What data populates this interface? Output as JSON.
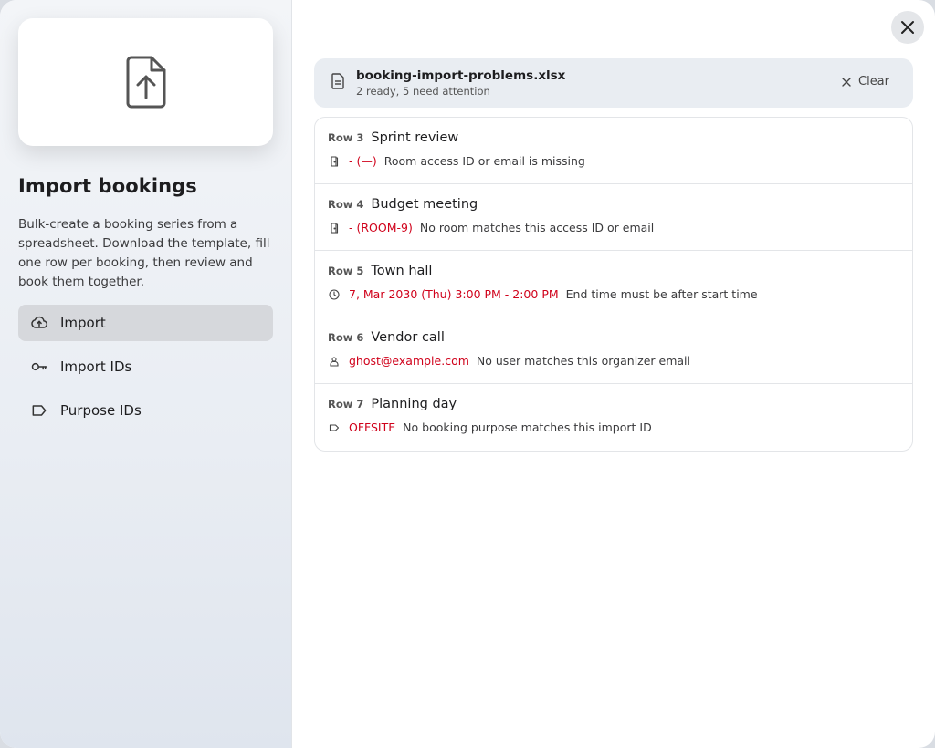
{
  "sidebar": {
    "title": "Import bookings",
    "description": "Bulk-create a booking series from a spreadsheet. Download the template, fill one row per booking, then review and book them together.",
    "nav": [
      {
        "label": "Import",
        "icon": "cloud-upload-icon",
        "active": true
      },
      {
        "label": "Import IDs",
        "icon": "key-icon",
        "active": false
      },
      {
        "label": "Purpose IDs",
        "icon": "tag-icon",
        "active": false
      }
    ]
  },
  "file": {
    "name": "booking-import-problems.xlsx",
    "status": "2 ready, 5 need attention",
    "clear_label": "Clear"
  },
  "issues": [
    {
      "row": "Row 3",
      "title": "Sprint review",
      "icon": "door-icon",
      "value": "- (—)",
      "message": "Room access ID or email is missing"
    },
    {
      "row": "Row 4",
      "title": "Budget meeting",
      "icon": "door-icon",
      "value": "- (ROOM-9)",
      "message": "No room matches this access ID or email"
    },
    {
      "row": "Row 5",
      "title": "Town hall",
      "icon": "clock-icon",
      "value": "7, Mar 2030 (Thu) 3:00 PM - 2:00 PM",
      "message": "End time must be after start time"
    },
    {
      "row": "Row 6",
      "title": "Vendor call",
      "icon": "person-icon",
      "value": "ghost@example.com",
      "message": "No user matches this organizer email"
    },
    {
      "row": "Row 7",
      "title": "Planning day",
      "icon": "tag-icon",
      "value": "OFFSITE",
      "message": "No booking purpose matches this import ID"
    }
  ],
  "colors": {
    "error": "#d0021b",
    "active_nav": "#d6d8dc",
    "file_bar": "#e9edf2"
  }
}
